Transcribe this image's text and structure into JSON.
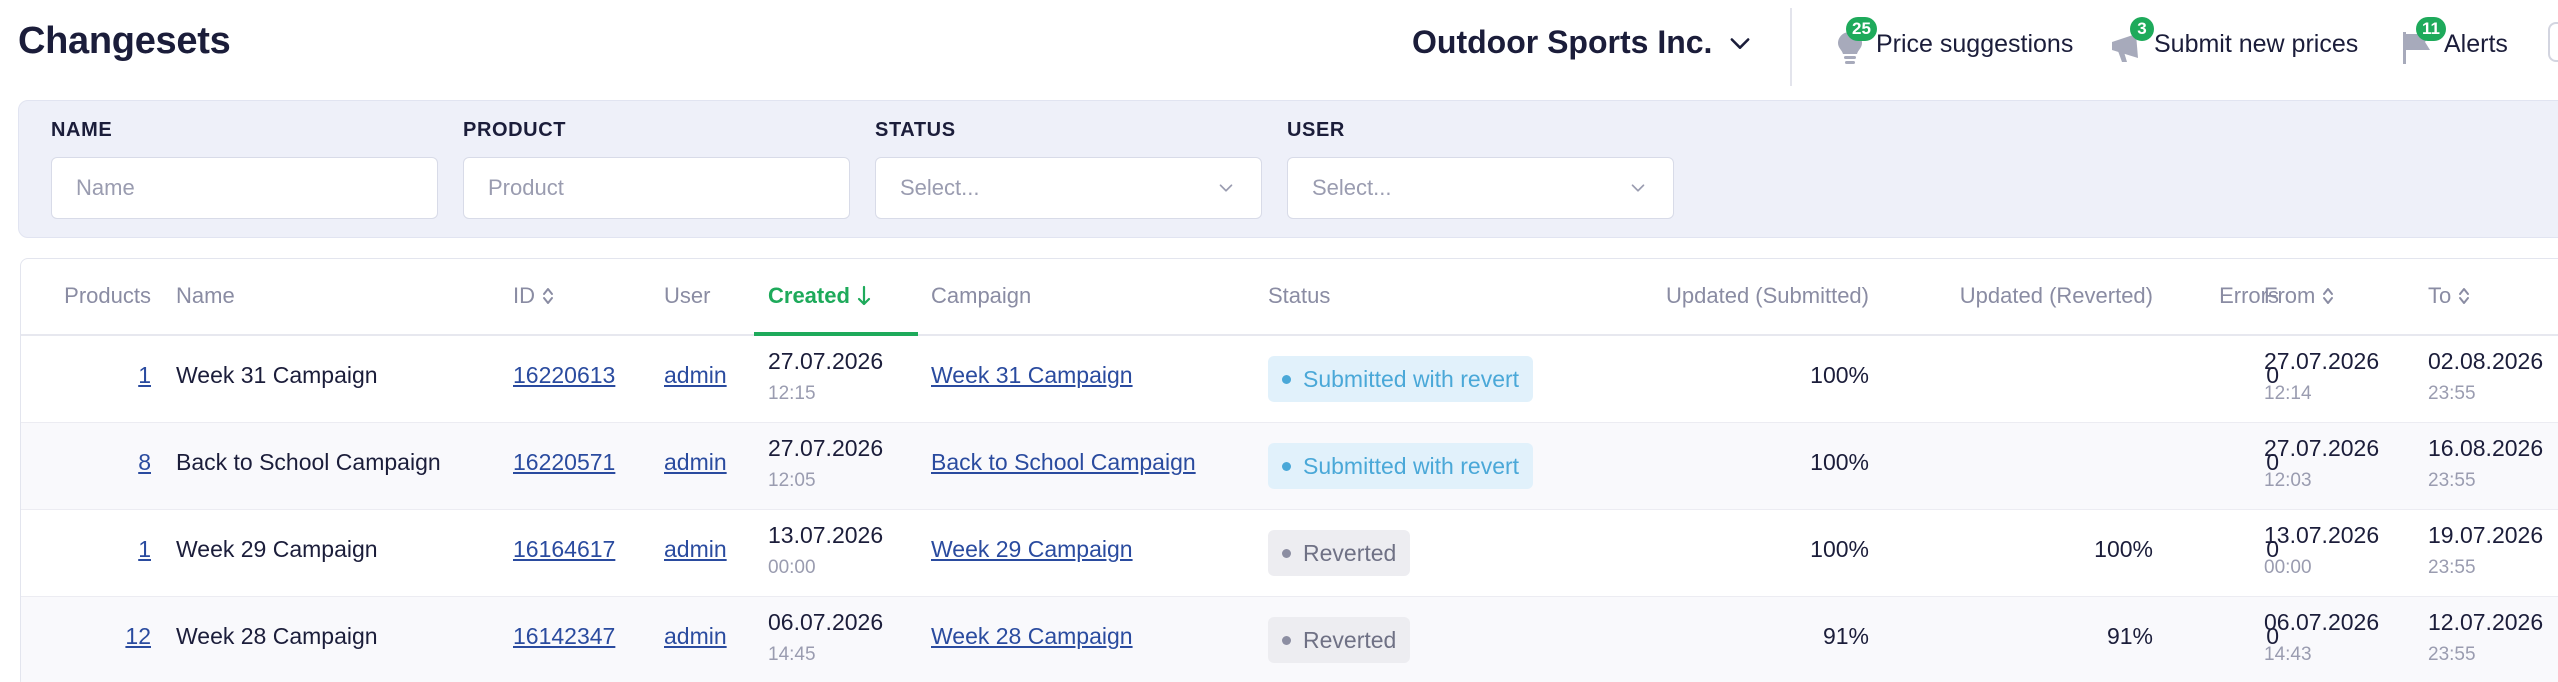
{
  "header": {
    "title": "Changesets",
    "company": "Outdoor Sports Inc.",
    "actions": [
      {
        "label": "Price suggestions",
        "badge": "25",
        "icon": "lightbulb-icon"
      },
      {
        "label": "Submit new prices",
        "badge": "3",
        "icon": "megaphone-icon"
      },
      {
        "label": "Alerts",
        "badge": "11",
        "icon": "flag-icon"
      }
    ]
  },
  "filters": {
    "name": {
      "label": "NAME",
      "placeholder": "Name"
    },
    "product": {
      "label": "PRODUCT",
      "placeholder": "Product"
    },
    "status": {
      "label": "STATUS",
      "placeholder": "Select..."
    },
    "user": {
      "label": "USER",
      "placeholder": "Select..."
    }
  },
  "table": {
    "columns": {
      "products": "Products",
      "name": "Name",
      "id": "ID",
      "user": "User",
      "created": "Created",
      "campaign": "Campaign",
      "status": "Status",
      "updated_submitted": "Updated (Submitted)",
      "updated_reverted": "Updated (Reverted)",
      "errors": "Errors",
      "from": "From",
      "to": "To"
    },
    "rows": [
      {
        "products": "1",
        "name": "Week 31 Campaign",
        "id": "16220613",
        "user": "admin",
        "created_date": "27.07.2026",
        "created_time": "12:15",
        "campaign": "Week 31 Campaign",
        "status": "Submitted with revert",
        "status_kind": "submitted",
        "updated_submitted": "100%",
        "updated_reverted": "",
        "errors": "0",
        "from_date": "27.07.2026",
        "from_time": "12:14",
        "to_date": "02.08.2026",
        "to_time": "23:55"
      },
      {
        "products": "8",
        "name": "Back to School Campaign",
        "id": "16220571",
        "user": "admin",
        "created_date": "27.07.2026",
        "created_time": "12:05",
        "campaign": "Back to School Campaign",
        "status": "Submitted with revert",
        "status_kind": "submitted",
        "updated_submitted": "100%",
        "updated_reverted": "",
        "errors": "0",
        "from_date": "27.07.2026",
        "from_time": "12:03",
        "to_date": "16.08.2026",
        "to_time": "23:55"
      },
      {
        "products": "1",
        "name": "Week 29 Campaign",
        "id": "16164617",
        "user": "admin",
        "created_date": "13.07.2026",
        "created_time": "00:00",
        "campaign": "Week 29 Campaign",
        "status": "Reverted",
        "status_kind": "reverted",
        "updated_submitted": "100%",
        "updated_reverted": "100%",
        "errors": "0",
        "from_date": "13.07.2026",
        "from_time": "00:00",
        "to_date": "19.07.2026",
        "to_time": "23:55"
      },
      {
        "products": "12",
        "name": "Week 28 Campaign",
        "id": "16142347",
        "user": "admin",
        "created_date": "06.07.2026",
        "created_time": "14:45",
        "campaign": "Week 28 Campaign",
        "status": "Reverted",
        "status_kind": "reverted",
        "updated_submitted": "91%",
        "updated_reverted": "91%",
        "errors": "0",
        "from_date": "06.07.2026",
        "from_time": "14:43",
        "to_date": "12.07.2026",
        "to_time": "23:55"
      }
    ]
  },
  "colors": {
    "accent_green": "#1eaa5b",
    "link_blue": "#2a4b9f",
    "submitted_blue": "#4aa8d8",
    "title_navy": "#1b1d3a"
  }
}
